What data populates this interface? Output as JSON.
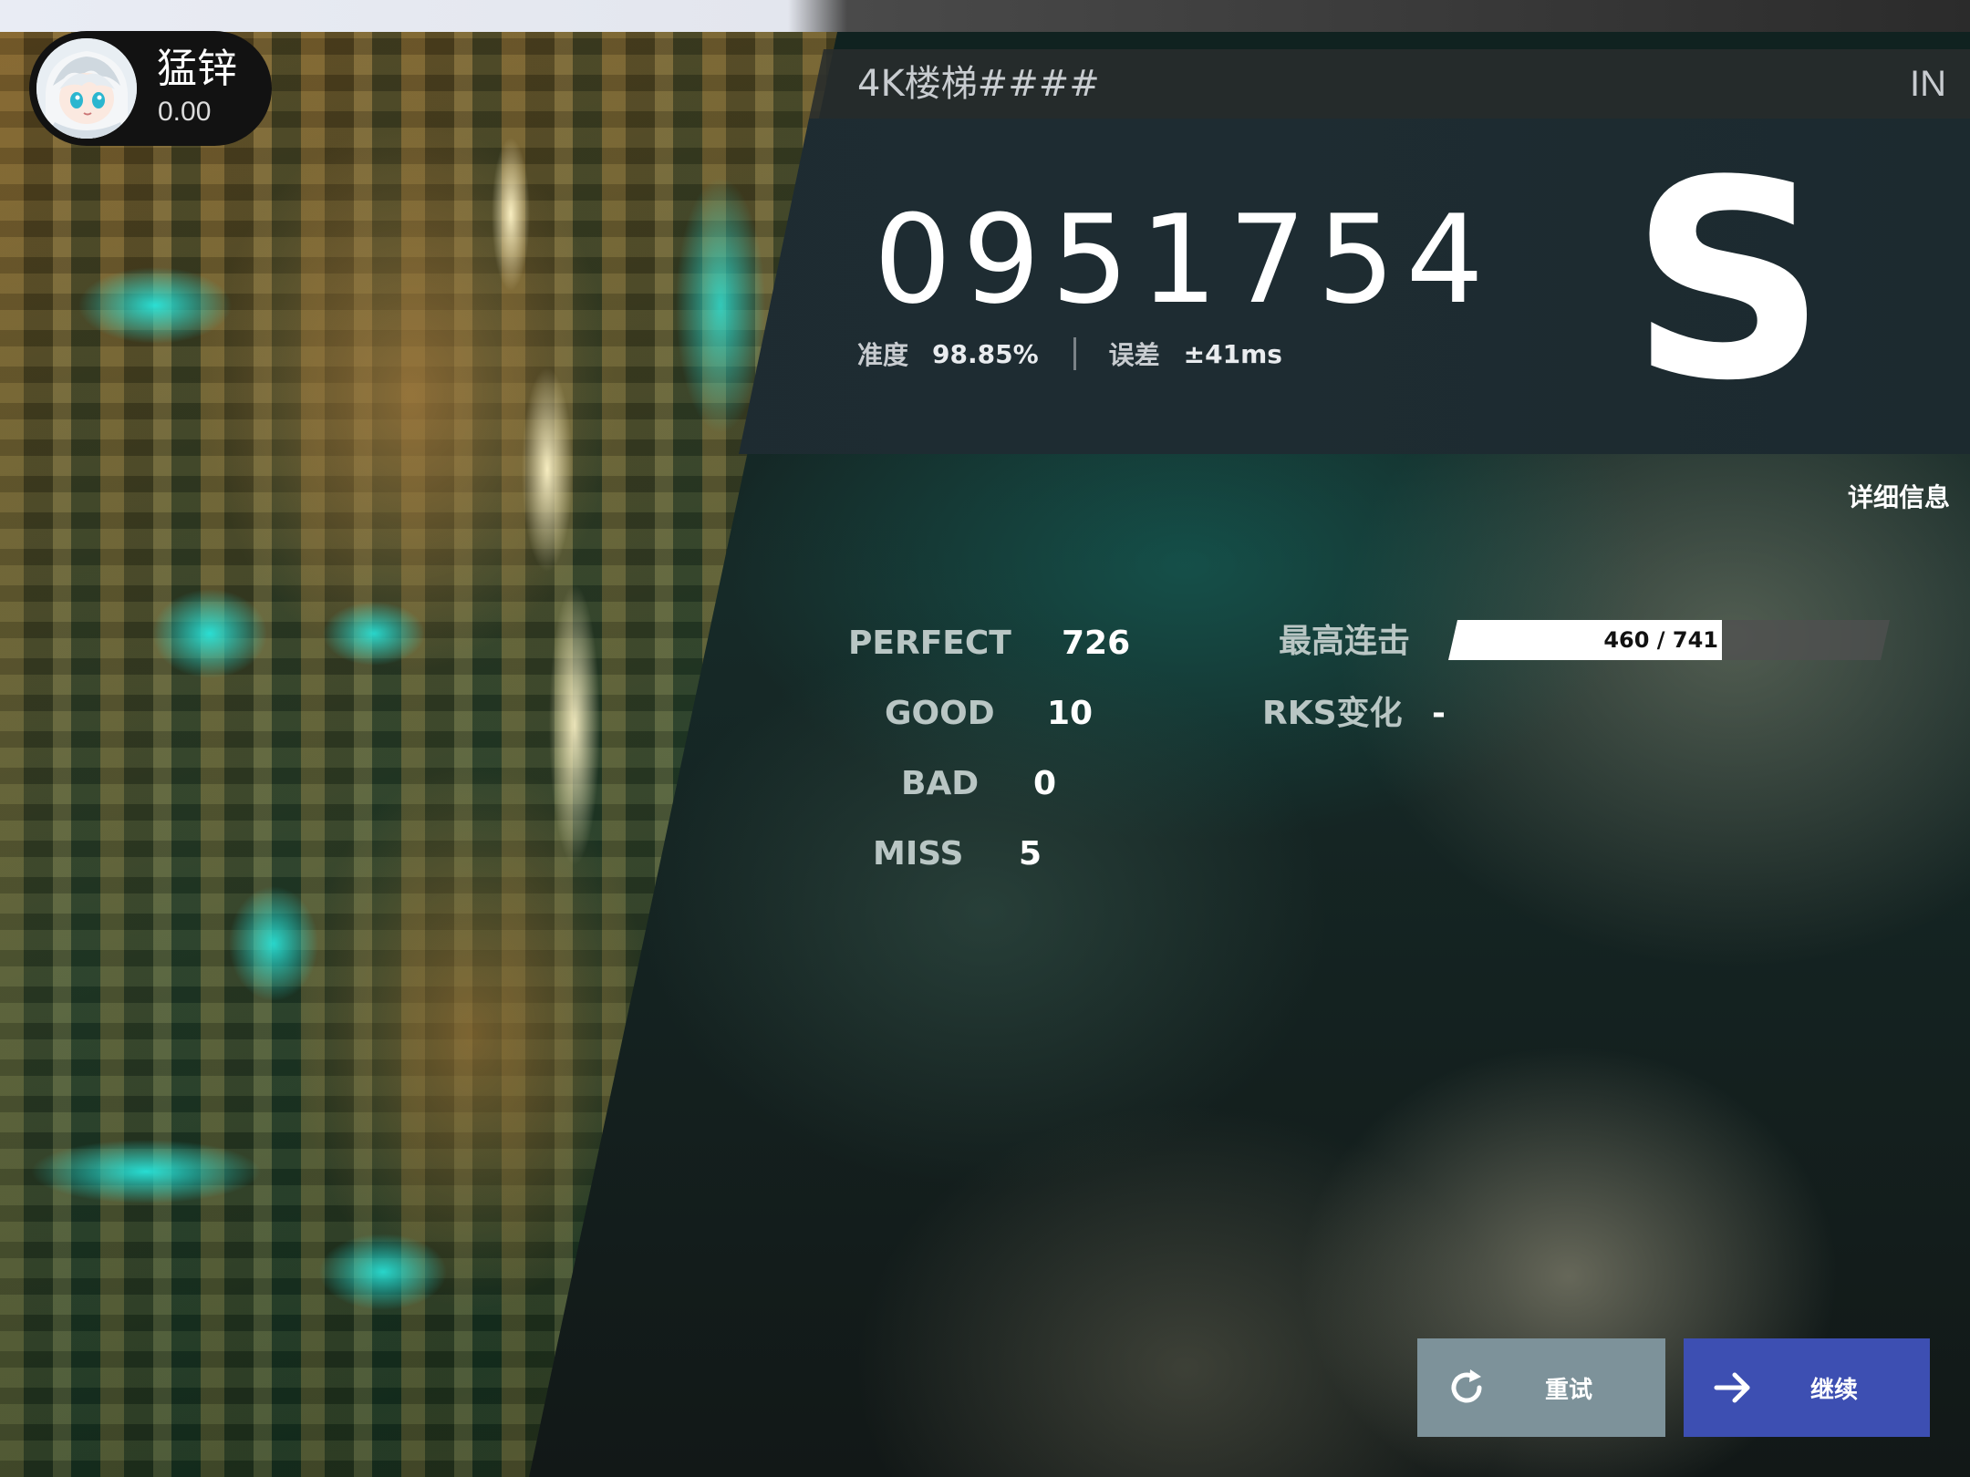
{
  "player": {
    "name": "猛锌",
    "rks": "0.00"
  },
  "song": {
    "title": "4K楼梯####",
    "difficulty": "IN"
  },
  "result": {
    "score": "0951754",
    "grade": "S",
    "accuracy_label": "准度",
    "accuracy_value": "98.85%",
    "error_label": "误差",
    "error_value": "±41ms",
    "details_link": "详细信息"
  },
  "judgements": {
    "perfect_label": "PERFECT",
    "perfect_value": "726",
    "good_label": "GOOD",
    "good_value": "10",
    "bad_label": "BAD",
    "bad_value": "0",
    "miss_label": "MISS",
    "miss_value": "5"
  },
  "combo": {
    "label": "最高连击",
    "max_combo": 460,
    "total_notes": 741,
    "text": "460 / 741"
  },
  "rks_change": {
    "label": "RKS变化",
    "value": "-"
  },
  "buttons": {
    "retry_label": "重试",
    "continue_label": "继续"
  },
  "colors": {
    "retry_button": "#7d929a",
    "continue_button": "#3d4fb2",
    "score_panel": "#1d2a30",
    "accent_cyan": "#28e6dc"
  },
  "icons": {
    "retry": "refresh-icon",
    "continue": "arrow-right-icon"
  }
}
